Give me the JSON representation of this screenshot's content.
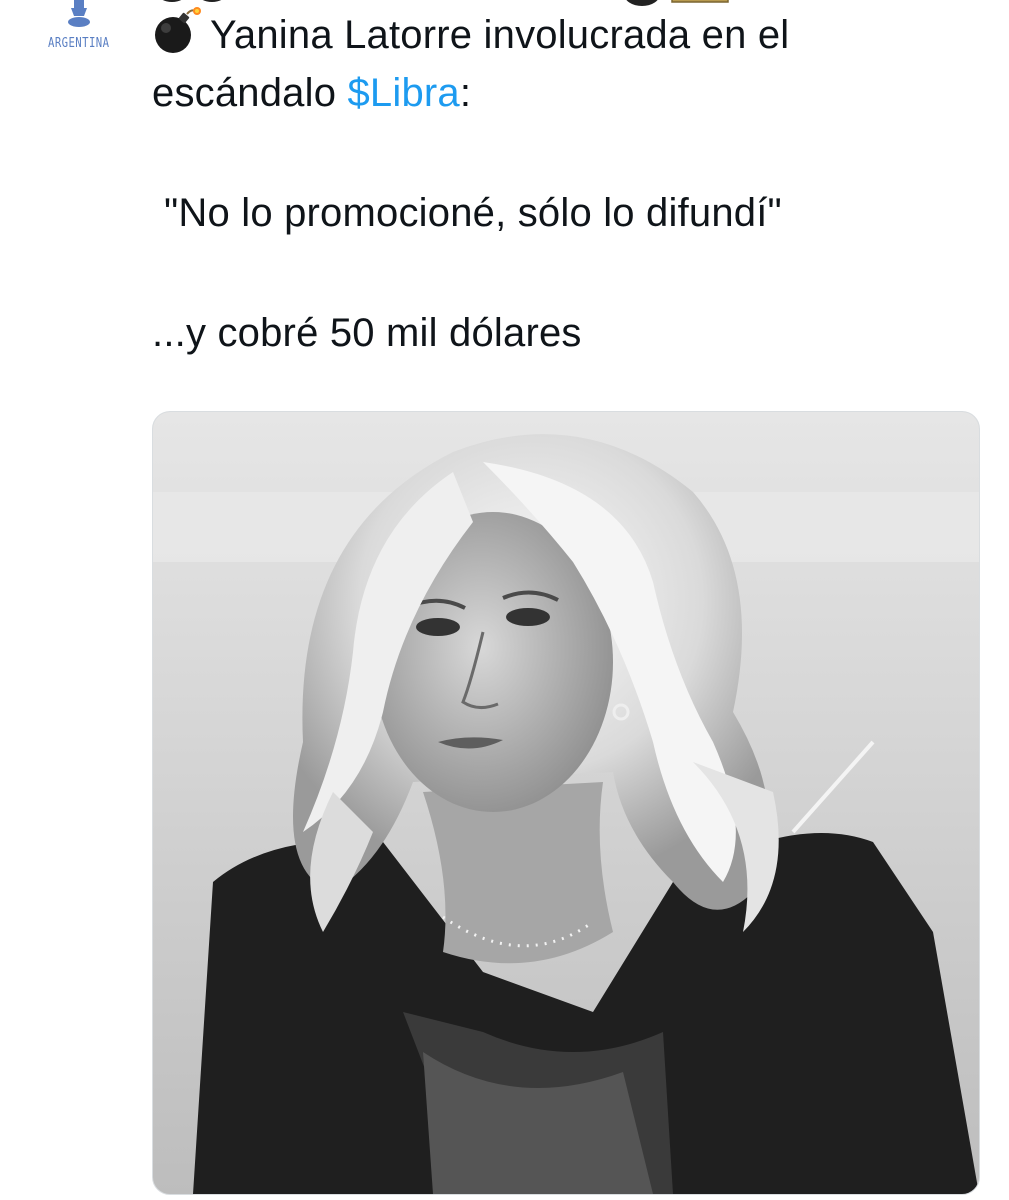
{
  "account": {
    "avatar_label": "ARGENTINA",
    "avatar_icon": "pedestal-trophy-icon"
  },
  "tweet": {
    "leading_emoji": "bomb-emoji",
    "line1_before_hashtag": "Yanina Latorre involucrada en el",
    "line2_before_hashtag": "escándalo ",
    "hashtag": "$Libra",
    "line2_after_hashtag": ":",
    "quote": "\"No lo promocioné, sólo lo difundí\"",
    "closing": "...y cobré 50 mil dólares"
  },
  "media": {
    "kind": "photo",
    "style": "black-and-white",
    "subject": "woman with wavy blonde hair in a dark blazer, looking sideways"
  },
  "colors": {
    "text": "#0f1419",
    "hashtag": "#1d9bf0",
    "avatar_accent": "#5a7fc3"
  }
}
